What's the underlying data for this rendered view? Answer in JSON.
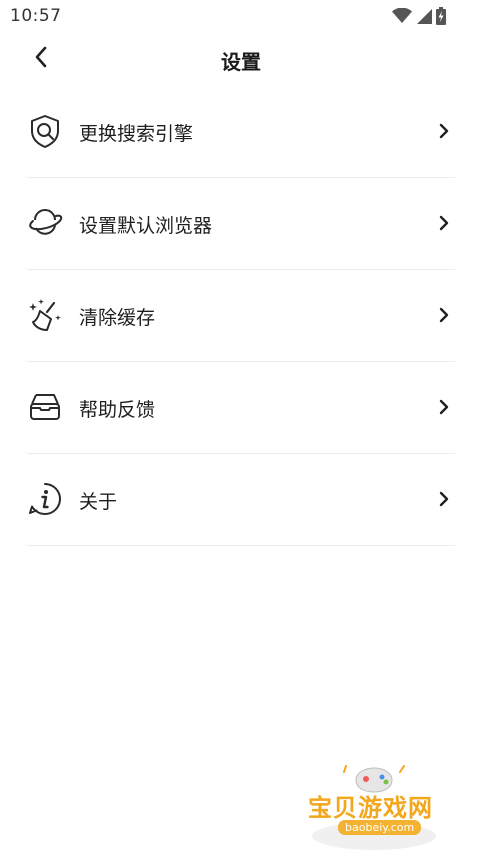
{
  "status_bar": {
    "time": "10:57",
    "icons": [
      "wifi-icon",
      "signal-icon",
      "battery-charging-icon"
    ]
  },
  "header": {
    "title": "设置",
    "back_icon": "chevron-left-icon"
  },
  "settings": {
    "items": [
      {
        "label": "更换搜索引擎",
        "icon": "search-shield-icon"
      },
      {
        "label": "设置默认浏览器",
        "icon": "planet-icon"
      },
      {
        "label": "清除缓存",
        "icon": "broom-sparkle-icon"
      },
      {
        "label": "帮助反馈",
        "icon": "inbox-icon"
      },
      {
        "label": "关于",
        "icon": "info-circle-icon"
      }
    ],
    "chevron_icon": "chevron-right-icon"
  },
  "watermark": {
    "title": "宝贝游戏网",
    "url": "baobeiy.com"
  },
  "colors": {
    "background": "#ffffff",
    "text": "#1f1f1f",
    "divider": "#ededed",
    "watermark": "#f3a71d"
  }
}
